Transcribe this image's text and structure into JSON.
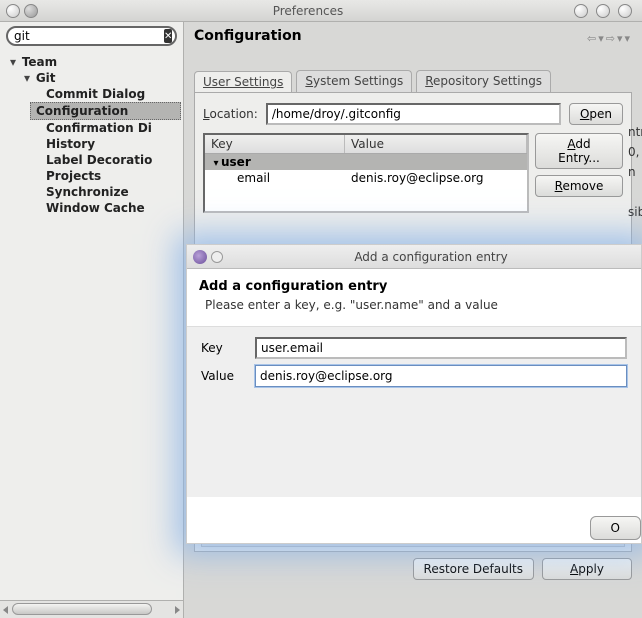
{
  "window": {
    "title": "Preferences"
  },
  "sidebar": {
    "search_value": "git",
    "tree": {
      "root": {
        "label": "Team",
        "expanded": true
      },
      "git": {
        "label": "Git",
        "expanded": true
      },
      "items": [
        "Commit Dialog",
        "Configuration",
        "Confirmation Di",
        "History",
        "Label Decoratio",
        "Projects",
        "Synchronize",
        "Window Cache"
      ],
      "selected_index": 1
    }
  },
  "content": {
    "heading": "Configuration",
    "tabs": [
      {
        "label": "User Settings",
        "mnemonic": "U",
        "active": true
      },
      {
        "label": "System Settings",
        "mnemonic": "S",
        "active": false
      },
      {
        "label": "Repository Settings",
        "mnemonic": "R",
        "active": false
      }
    ],
    "location": {
      "label": "Location:",
      "mnemonic": "L",
      "value": "/home/droy/.gitconfig"
    },
    "open": {
      "label": "Open",
      "mnemonic": "O"
    },
    "table": {
      "headers": {
        "key": "Key",
        "value": "Value"
      },
      "rows": [
        {
          "type": "group",
          "key": "user",
          "value": ""
        },
        {
          "type": "leaf",
          "key": "email",
          "value": "denis.roy@eclipse.org"
        }
      ]
    },
    "add_entry": {
      "label": "Add Entry...",
      "mnemonic": "A"
    },
    "remove": {
      "label": "Remove",
      "mnemonic": "R"
    },
    "restore": "Restore Defaults",
    "apply": {
      "label": "Apply",
      "mnemonic": "A"
    }
  },
  "dialog": {
    "title": "Add a configuration entry",
    "heading": "Add a configuration entry",
    "subtext": "Please enter a key, e.g. \"user.name\" and a value",
    "key": {
      "label": "Key",
      "mnemonic": "K",
      "value": "user.email"
    },
    "value": {
      "label": "Value",
      "mnemonic": "V",
      "value": "denis.roy@eclipse.org"
    },
    "ok_partial": "O"
  },
  "cutoff_text": [
    "ntr",
    "0,",
    "n",
    " ",
    "sib",
    " ",
    " ",
    "sib"
  ]
}
